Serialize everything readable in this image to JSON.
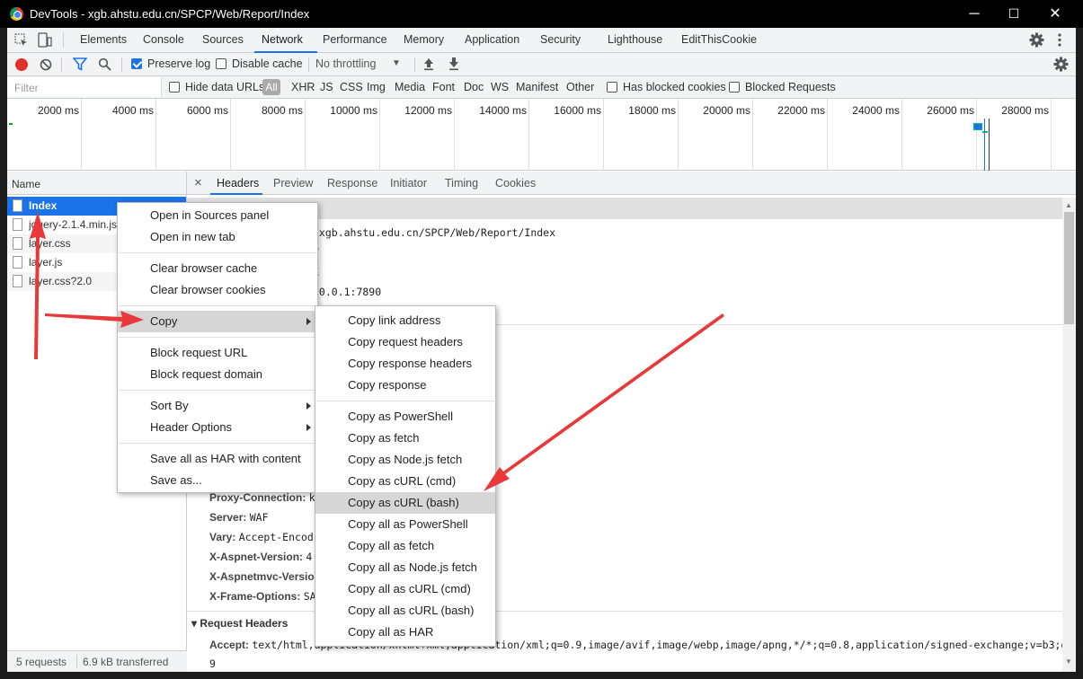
{
  "window": {
    "title": "DevTools - xgb.ahstu.edu.cn/SPCP/Web/Report/Index",
    "minimize": "─",
    "maximize": "☐",
    "close": "✕"
  },
  "tabs": [
    "Elements",
    "Console",
    "Sources",
    "Network",
    "Performance",
    "Memory",
    "Application",
    "Security",
    "Lighthouse",
    "EditThisCookie"
  ],
  "active_tab": "Network",
  "toolbar": {
    "preserve_log": "Preserve log",
    "disable_cache": "Disable cache",
    "throttling": "No throttling"
  },
  "filterbar": {
    "placeholder": "Filter",
    "hide_data_urls": "Hide data URLs",
    "types": [
      "All",
      "XHR",
      "JS",
      "CSS",
      "Img",
      "Media",
      "Font",
      "Doc",
      "WS",
      "Manifest",
      "Other"
    ],
    "has_blocked_cookies": "Has blocked cookies",
    "blocked_requests": "Blocked Requests"
  },
  "overview_ticks": [
    "2000 ms",
    "4000 ms",
    "6000 ms",
    "8000 ms",
    "10000 ms",
    "12000 ms",
    "14000 ms",
    "16000 ms",
    "18000 ms",
    "20000 ms",
    "22000 ms",
    "24000 ms",
    "26000 ms",
    "28000 ms"
  ],
  "requests": {
    "header": "Name",
    "items": [
      "Index",
      "jquery-2.1.4.min.js",
      "layer.css",
      "layer.js",
      "layer.css?2.0"
    ]
  },
  "status": {
    "requests": "5 requests",
    "transferred": "6.9 kB transferred"
  },
  "detail_tabs": [
    "Headers",
    "Preview",
    "Response",
    "Initiator",
    "Timing",
    "Cookies"
  ],
  "detail_close": "×",
  "general": {
    "url_tail": "/xgb.ahstu.edu.cn/SPCP/Web/Report/Index",
    "method_tail": "T",
    "status_tail": "K",
    "remote_tail": ".0.0.1:7890"
  },
  "response_headers": [
    {
      "k": "Proxy-Connection:",
      "v": "k"
    },
    {
      "k": "Server:",
      "v": "WAF"
    },
    {
      "k": "Vary:",
      "v": "Accept-Encod:"
    },
    {
      "k": "X-Aspnet-Version:",
      "v": "4"
    },
    {
      "k": "X-Aspnetmvc-Version",
      "v": ""
    },
    {
      "k": "X-Frame-Options:",
      "v": "SA"
    }
  ],
  "request_headers_title": "▾ Request Headers",
  "accept_header": {
    "k": "Accept:",
    "v": "text/html,application/xhtml+xml,application/xml;q=0.9,image/avif,image/webp,image/apng,*/*;q=0.8,application/signed-exchange;v=b3;q=0.",
    "v2": "9"
  },
  "context_menu": {
    "items": [
      "Open in Sources panel",
      "Open in new tab",
      "Clear browser cache",
      "Clear browser cookies",
      "Copy",
      "Block request URL",
      "Block request domain",
      "Sort By",
      "Header Options",
      "Save all as HAR with content",
      "Save as..."
    ]
  },
  "copy_submenu": {
    "items": [
      "Copy link address",
      "Copy request headers",
      "Copy response headers",
      "Copy response",
      "Copy as PowerShell",
      "Copy as fetch",
      "Copy as Node.js fetch",
      "Copy as cURL (cmd)",
      "Copy as cURL (bash)",
      "Copy all as PowerShell",
      "Copy all as fetch",
      "Copy all as Node.js fetch",
      "Copy all as cURL (cmd)",
      "Copy all as cURL (bash)",
      "Copy all as HAR"
    ],
    "highlighted": "Copy as cURL (bash)"
  },
  "colors": {
    "accent": "#1a73e8",
    "record": "#e0322a",
    "annotation_arrow": "#e8383a"
  }
}
